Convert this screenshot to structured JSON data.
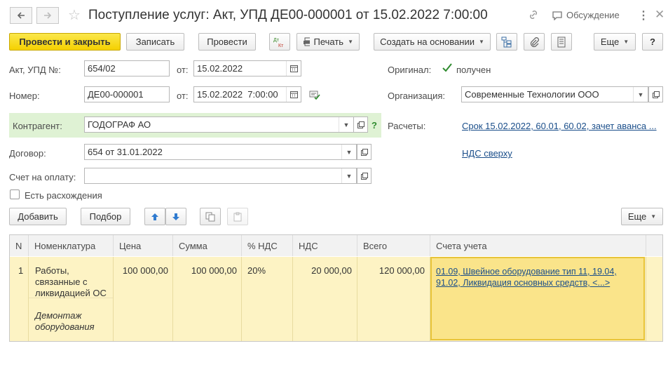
{
  "window": {
    "title": "Поступление услуг: Акт, УПД ДЕ00-000001 от 15.02.2022 7:00:00",
    "discussion_label": "Обсуждение"
  },
  "toolbar": {
    "post_close": "Провести и закрыть",
    "save": "Записать",
    "post": "Провести",
    "dt_kt": "Дт Кт",
    "print": "Печать",
    "create_based": "Создать на основании",
    "more": "Еще",
    "help": "?"
  },
  "form": {
    "act_label": "Акт, УПД №:",
    "act_value": "654/02",
    "act_date_label": "от:",
    "act_date": "15.02.2022",
    "number_label": "Номер:",
    "number_value": "ДЕ00-000001",
    "number_date_label": "от:",
    "number_date": "15.02.2022  7:00:00",
    "original_label": "Оригинал:",
    "original_value": "получен",
    "original_checked": true,
    "org_label": "Организация:",
    "org_value": "Современные Технологии ООО",
    "counterparty_label": "Контрагент:",
    "counterparty_value": "ГОДОГРАФ АО",
    "settlements_label": "Расчеты:",
    "settlements_link": "Срок 15.02.2022, 60.01, 60.02, зачет аванса ...",
    "contract_label": "Договор:",
    "contract_value": "654 от 31.01.2022",
    "vat_link": "НДС сверху",
    "invoice_label": "Счет на оплату:",
    "invoice_value": "",
    "discrepancy_label": "Есть расхождения",
    "discrepancy_checked": false
  },
  "table_toolbar": {
    "add": "Добавить",
    "pick": "Подбор",
    "more": "Еще"
  },
  "table": {
    "headers": [
      "N",
      "Номенклатура",
      "Цена",
      "Сумма",
      "% НДС",
      "НДС",
      "Всего",
      "Счета учета"
    ],
    "rows": [
      {
        "n": "1",
        "item": "Работы, связанные с ликвидацией ОС",
        "item_note": "Демонтаж оборудования",
        "price": "100 000,00",
        "sum": "100 000,00",
        "vat_rate": "20%",
        "vat": "20 000,00",
        "total": "120 000,00",
        "accounts_line1": "01.09, Швейное оборудование тип 11, 19.04,",
        "accounts_line2": "91.02, Ликвидация основных средств, <...>"
      }
    ]
  },
  "colors": {
    "primary": "#f5d100",
    "row_highlight": "#fdf3c4",
    "selected_cell": "#fae48a",
    "counterparty_bg": "#dff2d4",
    "link": "#1a4e8a"
  }
}
